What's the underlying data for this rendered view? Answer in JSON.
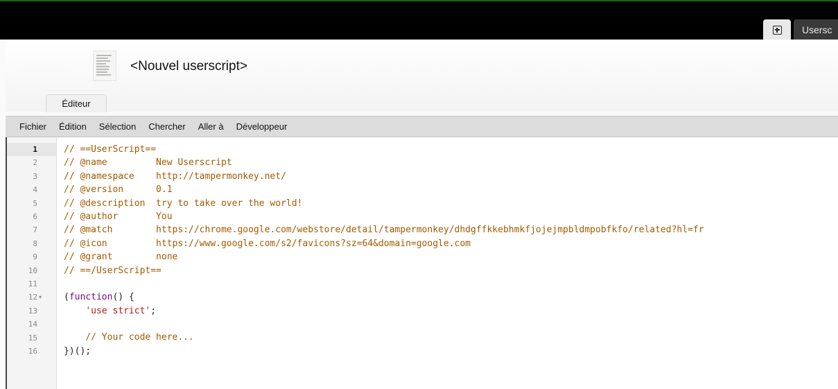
{
  "window": {
    "tabs": {
      "userscripts_label": "Usersc"
    }
  },
  "header": {
    "title": "<Nouvel userscript>",
    "editor_tab_label": "Éditeur"
  },
  "menubar": {
    "items": [
      "Fichier",
      "Édition",
      "Sélection",
      "Chercher",
      "Aller à",
      "Développeur"
    ]
  },
  "editor": {
    "active_line": 1,
    "fold_marker_line": 12,
    "line_numbers": [
      "1",
      "2",
      "3",
      "4",
      "5",
      "6",
      "7",
      "8",
      "9",
      "10",
      "11",
      "12",
      "13",
      "14",
      "15",
      "16"
    ],
    "code": [
      {
        "type": "comment",
        "text": "// ==UserScript=="
      },
      {
        "type": "comment",
        "text": "// @name         New Userscript"
      },
      {
        "type": "comment",
        "text": "// @namespace    http://tampermonkey.net/"
      },
      {
        "type": "comment",
        "text": "// @version      0.1"
      },
      {
        "type": "comment",
        "text": "// @description  try to take over the world!"
      },
      {
        "type": "comment",
        "text": "// @author       You"
      },
      {
        "type": "comment",
        "text": "// @match        https://chrome.google.com/webstore/detail/tampermonkey/dhdgffkkebhmkfjojejmpbldmpobfkfo/related?hl=fr"
      },
      {
        "type": "comment",
        "text": "// @icon         https://www.google.com/s2/favicons?sz=64&domain=google.com"
      },
      {
        "type": "comment",
        "text": "// @grant        none"
      },
      {
        "type": "comment",
        "text": "// ==/UserScript=="
      },
      {
        "type": "plain",
        "text": ""
      },
      {
        "type": "mixed",
        "parts": [
          {
            "c": "plain",
            "t": "("
          },
          {
            "c": "kw",
            "t": "function"
          },
          {
            "c": "plain",
            "t": "() {"
          }
        ]
      },
      {
        "type": "mixed",
        "parts": [
          {
            "c": "plain",
            "t": "    "
          },
          {
            "c": "str",
            "t": "'use strict'"
          },
          {
            "c": "plain",
            "t": ";"
          }
        ]
      },
      {
        "type": "plain",
        "text": ""
      },
      {
        "type": "comment",
        "text": "    // Your code here..."
      },
      {
        "type": "plain",
        "text": "})();"
      }
    ]
  },
  "colors": {
    "comment": "#a35a00",
    "keyword": "#7a0a8a",
    "string": "#b5171d",
    "top_accent": "#0f6b0f"
  },
  "icons": [
    "new-tab-icon",
    "script-document-icon",
    "fold-arrow-icon"
  ]
}
